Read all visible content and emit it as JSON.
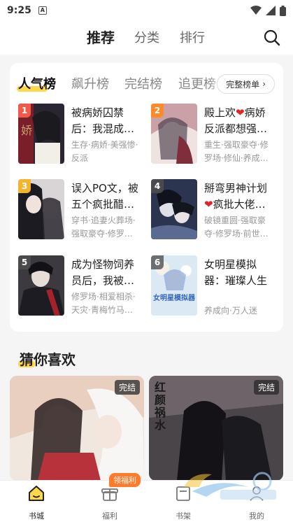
{
  "status_bar": {
    "time": "9:25",
    "notif_letter": "A"
  },
  "top_nav": {
    "tabs": [
      {
        "label": "推荐",
        "active": true
      },
      {
        "label": "分类",
        "active": false
      },
      {
        "label": "排行",
        "active": false
      }
    ]
  },
  "rank": {
    "tabs": [
      "人气榜",
      "飙升榜",
      "完结榜",
      "追更榜"
    ],
    "full_list_label": "完整榜单",
    "books": [
      {
        "num": "1",
        "title": "被病娇囚禁后：我混成…",
        "tags": "生存·病娇·美强惨·反派"
      },
      {
        "num": "2",
        "title_pre": "殿上欢",
        "title_post": "病娇反派都想强…",
        "tags": "重生·强取豪夺·修罗场·修仙·养成…"
      },
      {
        "num": "3",
        "title": "误入PO文，被五个疯批醋…",
        "tags": "穿书·追妻火葬场·强取豪夺·修罗…"
      },
      {
        "num": "4",
        "title_pre": "掰弯男神计划",
        "title_post": "疯批大佬…",
        "tags": "破镜重圆·强取豪夺·修罗场·前世…"
      },
      {
        "num": "5",
        "title": "成为怪物饲养员后，我被…",
        "tags": "修罗场·相爱相杀·天灾·青梅竹马…"
      },
      {
        "num": "6",
        "title": "女明星模拟器：璀璨人生",
        "tags": "养成向·万人迷"
      }
    ],
    "cover_texts": {
      "b6": "女明星模拟器"
    }
  },
  "guess": {
    "title": "猜你喜欢",
    "cards": [
      {
        "badge": "完结"
      },
      {
        "badge": "完结",
        "cover_text": "红颜祸水"
      }
    ]
  },
  "bottom_nav": {
    "items": [
      {
        "label": "书城",
        "active": true
      },
      {
        "label": "福利",
        "active": false
      },
      {
        "label": "书架",
        "active": false
      },
      {
        "label": "我的",
        "active": false
      }
    ],
    "welfare_badge": "领福利"
  },
  "colors": {
    "accent": "#ffd84a",
    "rank1": "#ef5a4a",
    "rank2": "#ff8a2b",
    "rank3": "#f4b42c",
    "badge": "#ff7a2b"
  }
}
